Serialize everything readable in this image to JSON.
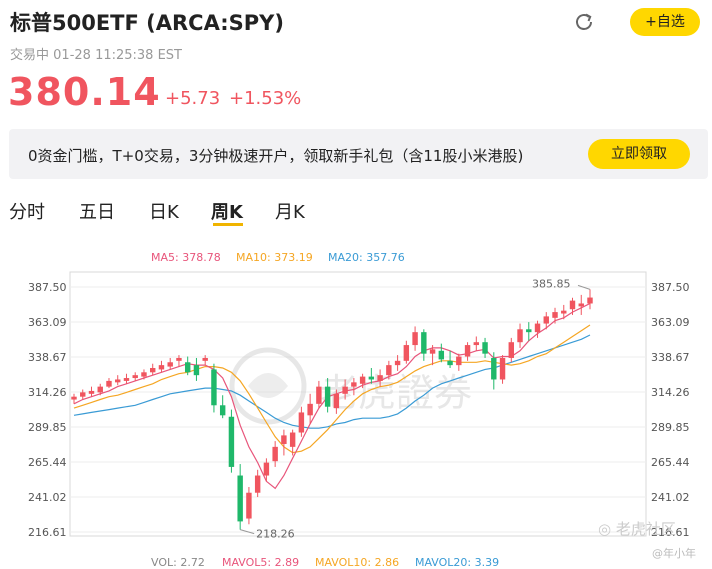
{
  "header": {
    "title": "标普500ETF (ARCA:SPY)",
    "add_watchlist": "+自选",
    "status": "交易中",
    "datetime": "01-28 11:25:38 EST"
  },
  "quote": {
    "price": "380.14",
    "change": "+5.73",
    "change_pct": "+1.53%"
  },
  "banner": {
    "text": "0资金门槛，T+0交易，3分钟极速开户，领取新手礼包（含11股小米港股)",
    "button": "立即领取"
  },
  "tabs": [
    {
      "label": "分时",
      "active": false
    },
    {
      "label": "五日",
      "active": false
    },
    {
      "label": "日K",
      "active": false
    },
    {
      "label": "周K",
      "active": true
    },
    {
      "label": "月K",
      "active": false
    }
  ],
  "ma_legend": {
    "ma5": "MA5: 378.78",
    "ma10": "MA10: 373.19",
    "ma20": "MA20: 357.76"
  },
  "vol_legend": {
    "vol": "VOL: 2.72",
    "mavol5": "MAVOL5: 2.89",
    "mavol10": "MAVOL10: 2.86",
    "mavol20": "MAVOL20: 3.39"
  },
  "watermark": {
    "center": "老虎證券",
    "corner": "老虎社区",
    "author": "@年小年"
  },
  "colors": {
    "up": "#f0555f",
    "down": "#1fb86a",
    "ma5": "#e8557b",
    "ma10": "#f5a623",
    "ma20": "#3a9bd5",
    "accent": "#ffd700"
  },
  "chart_data": {
    "type": "candlestick",
    "interval": "weekly",
    "y_ticks": [
      "387.50",
      "363.09",
      "338.67",
      "314.26",
      "289.85",
      "265.44",
      "241.02",
      "216.61"
    ],
    "ylim": [
      216.61,
      387.5
    ],
    "high_label": "385.85",
    "low_label": "218.26",
    "candles": [
      [
        309,
        313,
        306,
        311
      ],
      [
        311,
        316,
        309,
        314
      ],
      [
        313,
        318,
        311,
        315
      ],
      [
        314,
        320,
        312,
        318
      ],
      [
        318,
        324,
        317,
        322
      ],
      [
        321,
        326,
        319,
        323
      ],
      [
        322,
        327,
        320,
        324
      ],
      [
        324,
        328,
        322,
        326
      ],
      [
        325,
        330,
        323,
        328
      ],
      [
        328,
        334,
        326,
        331
      ],
      [
        330,
        336,
        328,
        333
      ],
      [
        332,
        338,
        330,
        335
      ],
      [
        336,
        340,
        332,
        338
      ],
      [
        335,
        339,
        326,
        328
      ],
      [
        333,
        338,
        322,
        326
      ],
      [
        336,
        340,
        333,
        338
      ],
      [
        330,
        334,
        300,
        305
      ],
      [
        305,
        312,
        296,
        298
      ],
      [
        297,
        302,
        258,
        262
      ],
      [
        256,
        264,
        218.26,
        224
      ],
      [
        226,
        248,
        222,
        244
      ],
      [
        244,
        260,
        241,
        256
      ],
      [
        256,
        268,
        252,
        265
      ],
      [
        266,
        280,
        262,
        276
      ],
      [
        278,
        288,
        270,
        284
      ],
      [
        276,
        288,
        270,
        286
      ],
      [
        286,
        304,
        283,
        300
      ],
      [
        298,
        313,
        292,
        306
      ],
      [
        306,
        322,
        303,
        318
      ],
      [
        318,
        324,
        300,
        304
      ],
      [
        303,
        316,
        299,
        313
      ],
      [
        313,
        323,
        309,
        318
      ],
      [
        318,
        324,
        312,
        321
      ],
      [
        320,
        327,
        317,
        325
      ],
      [
        325,
        331,
        320,
        323
      ],
      [
        322,
        330,
        318,
        326
      ],
      [
        326,
        336,
        323,
        333
      ],
      [
        333,
        340,
        329,
        336
      ],
      [
        336,
        350,
        334,
        347
      ],
      [
        347,
        360,
        343,
        356
      ],
      [
        356,
        358,
        336,
        341
      ],
      [
        341,
        347,
        333,
        344
      ],
      [
        343,
        348,
        335,
        337
      ],
      [
        336,
        343,
        331,
        333
      ],
      [
        333,
        341,
        329,
        339
      ],
      [
        339,
        349,
        336,
        347
      ],
      [
        347,
        353,
        343,
        349
      ],
      [
        349,
        352,
        338,
        341
      ],
      [
        338,
        342,
        316,
        323
      ],
      [
        323,
        340,
        320,
        338
      ],
      [
        338,
        352,
        335,
        349
      ],
      [
        349,
        362,
        345,
        358
      ],
      [
        358,
        363,
        350,
        356
      ],
      [
        356,
        364,
        352,
        362
      ],
      [
        362,
        370,
        358,
        367
      ],
      [
        366,
        373,
        362,
        370
      ],
      [
        369,
        375,
        365,
        371
      ],
      [
        372,
        380,
        368,
        378
      ],
      [
        374,
        382,
        368,
        376
      ],
      [
        376,
        385.85,
        372,
        380.14
      ]
    ],
    "ma5": [
      306,
      309,
      311,
      313,
      315,
      318,
      320,
      322,
      324,
      326,
      328,
      330,
      332,
      334,
      333,
      333,
      330,
      324,
      311,
      291,
      276,
      265,
      252,
      247,
      256,
      268,
      280,
      292,
      303,
      311,
      313,
      315,
      316,
      319,
      321,
      322,
      325,
      327,
      332,
      339,
      343,
      345,
      345,
      343,
      340,
      341,
      343,
      344,
      338,
      339,
      339,
      343,
      350,
      355,
      359,
      364,
      366,
      370,
      373,
      376
    ],
    "ma10": [
      303,
      305,
      307,
      309,
      311,
      312,
      314,
      316,
      318,
      320,
      323,
      325,
      327,
      328,
      330,
      332,
      332,
      331,
      328,
      322,
      313,
      303,
      293,
      283,
      276,
      272,
      273,
      276,
      282,
      288,
      295,
      302,
      308,
      313,
      316,
      318,
      319,
      321,
      325,
      329,
      332,
      334,
      336,
      336,
      335,
      335,
      335,
      336,
      335,
      334,
      333,
      334,
      336,
      339,
      341,
      345,
      349,
      353,
      357,
      361
    ],
    "ma20": [
      298,
      299,
      300,
      301,
      302,
      303,
      304,
      305,
      307,
      309,
      311,
      313,
      314,
      315,
      316,
      317,
      317,
      316,
      315,
      312,
      308,
      304,
      300,
      296,
      293,
      291,
      290,
      289,
      289,
      290,
      292,
      293,
      295,
      296,
      296,
      296,
      297,
      299,
      303,
      308,
      312,
      317,
      320,
      322,
      324,
      326,
      328,
      330,
      331,
      333,
      335,
      337,
      339,
      341,
      343,
      345,
      347,
      349,
      351,
      354
    ]
  }
}
